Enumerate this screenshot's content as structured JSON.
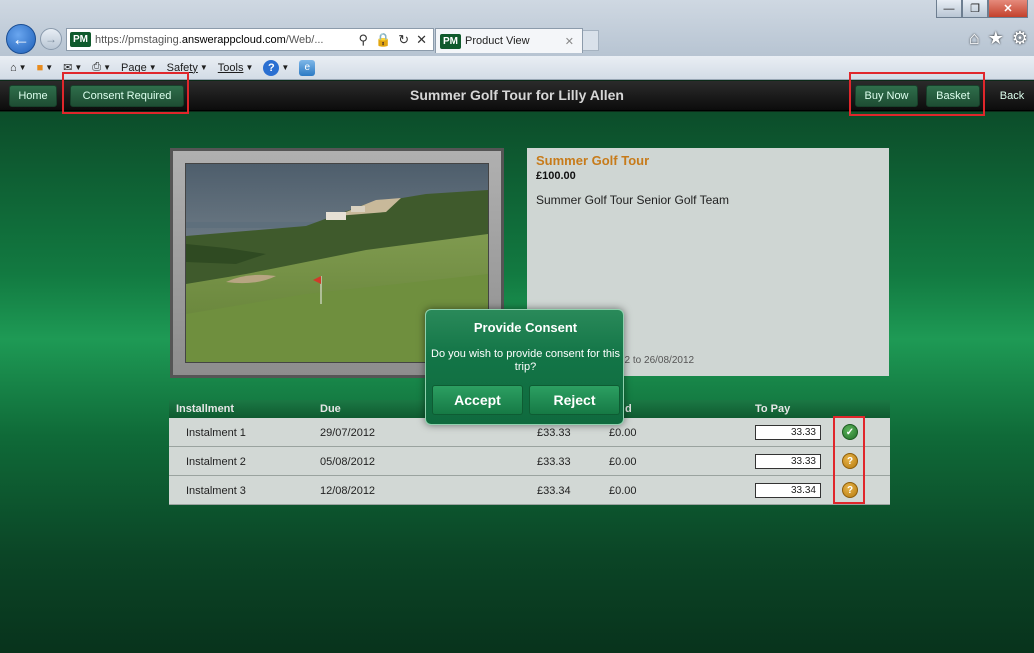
{
  "browser": {
    "url_prefix": "https://pmstaging.",
    "url_host": "answerappcloud.com",
    "url_rest": "/Web/...",
    "tab_title": "Product View",
    "tab_badge": "PM",
    "address_badge": "PM",
    "command_bar": [
      "Page",
      "Safety",
      "Tools"
    ]
  },
  "header": {
    "home_label": "Home",
    "consent_label": "Consent Required",
    "title": "Summer Golf Tour for Lilly Allen",
    "buy_now_label": "Buy Now",
    "basket_label": "Basket",
    "back_label": "Back"
  },
  "product": {
    "name": "Summer Golf Tour",
    "price": "£100.00",
    "description": "Summer Golf Tour Senior Golf Team",
    "dates_fragment": "12 to 26/08/2012"
  },
  "table": {
    "headers": [
      "Installment",
      "Due",
      "d",
      "To Pay"
    ],
    "rows": [
      {
        "name": "Instalment 1",
        "due": "29/07/2012",
        "amount": "£33.33",
        "paid": "£0.00",
        "to_pay": "33.33",
        "status": "paid"
      },
      {
        "name": "Instalment 2",
        "due": "05/08/2012",
        "amount": "£33.33",
        "paid": "£0.00",
        "to_pay": "33.33",
        "status": "pending"
      },
      {
        "name": "Instalment 3",
        "due": "12/08/2012",
        "amount": "£33.34",
        "paid": "£0.00",
        "to_pay": "33.34",
        "status": "pending"
      }
    ]
  },
  "modal": {
    "title": "Provide Consent",
    "message": "Do you wish to provide consent for this trip?",
    "accept_label": "Accept",
    "reject_label": "Reject"
  },
  "colors": {
    "brand_green": "#137547",
    "accent_orange": "#c77b1a",
    "annotation_red": "#e0262b"
  }
}
